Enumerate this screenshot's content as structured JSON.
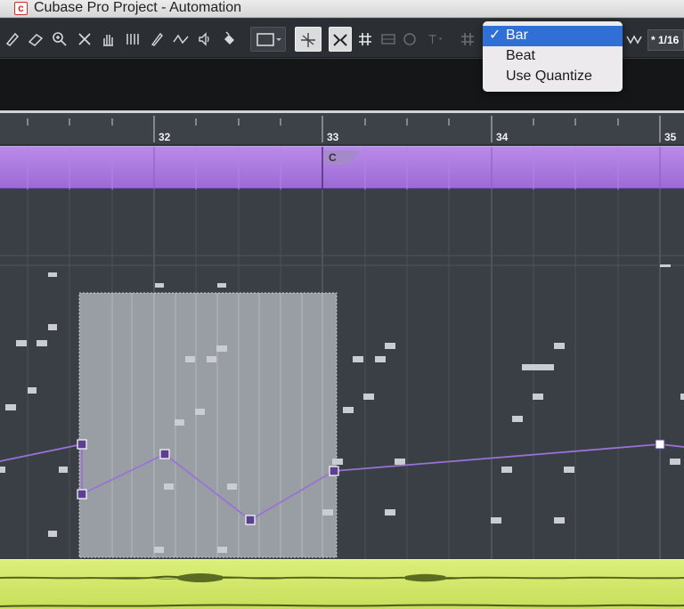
{
  "window": {
    "title": "Cubase Pro Project - Automation"
  },
  "toolbar": {
    "tools": [
      "select-tool",
      "range-tool",
      "zoom-tool",
      "erase-tool",
      "hand-tool",
      "split-tool",
      "draw-tool",
      "line-tool",
      "speaker-tool",
      "color-tool"
    ],
    "quantize_value": "* 1/16"
  },
  "grid_menu": {
    "items": [
      {
        "label": "Bar",
        "selected": true
      },
      {
        "label": "Beat",
        "selected": false
      },
      {
        "label": "Use Quantize",
        "selected": false
      }
    ],
    "checkmark": "✓"
  },
  "ruler": {
    "bars": [
      "32",
      "33",
      "34",
      "35"
    ]
  },
  "marker": {
    "label": "C"
  },
  "colors": {
    "accent": "#2f6fd6",
    "marker_track": "#a877e0",
    "automation_line": "#9a72d6",
    "audio_track": "#d2e66a"
  }
}
